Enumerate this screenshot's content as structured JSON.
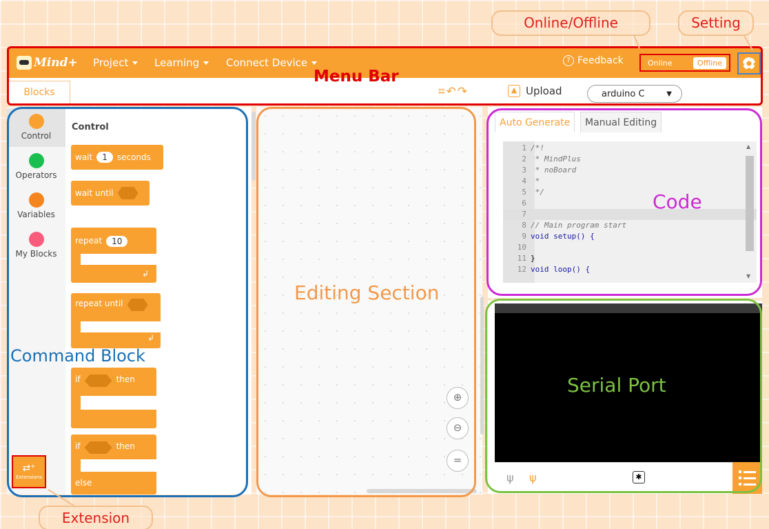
{
  "app": {
    "logo_text": "Mind+"
  },
  "menu": {
    "items": [
      {
        "label": "Project"
      },
      {
        "label": "Learning"
      },
      {
        "label": "Connect Device"
      }
    ],
    "feedback": "Feedback",
    "mode_online": "Online",
    "mode_offline": "Offline"
  },
  "toolbar": {
    "tab_blocks": "Blocks",
    "upload": "Upload",
    "board_select": "arduino C"
  },
  "categories": [
    {
      "label": "Control",
      "color": "#f8a131"
    },
    {
      "label": "Operators",
      "color": "#1bbf4f"
    },
    {
      "label": "Variables",
      "color": "#f5851f"
    },
    {
      "label": "My Blocks",
      "color": "#fa5c7c"
    }
  ],
  "flyout": {
    "title": "Control",
    "wait": {
      "label": "wait",
      "value": "1",
      "unit": "seconds"
    },
    "wait_until": "wait until",
    "repeat": {
      "label": "repeat",
      "value": "10"
    },
    "repeat_until": "repeat until",
    "if_then": {
      "if": "if",
      "then": "then"
    },
    "if_else": {
      "if": "if",
      "then": "then",
      "else": "else"
    }
  },
  "extensions_label": "Extensions",
  "code": {
    "tab_auto": "Auto Generate",
    "tab_manual": "Manual Editing",
    "lines": [
      {
        "n": "1",
        "text": "/*!",
        "cls": "cm"
      },
      {
        "n": "2",
        "text": " * MindPlus",
        "cls": "cm"
      },
      {
        "n": "3",
        "text": " * noBoard",
        "cls": "cm"
      },
      {
        "n": "4",
        "text": " *",
        "cls": "cm"
      },
      {
        "n": "5",
        "text": " */",
        "cls": "cm"
      },
      {
        "n": "6",
        "text": "",
        "cls": ""
      },
      {
        "n": "7",
        "text": "",
        "cls": ""
      },
      {
        "n": "8",
        "text": "// Main program start",
        "cls": "cm"
      },
      {
        "n": "9",
        "text": "void setup() {",
        "cls": "kw"
      },
      {
        "n": "10",
        "text": "",
        "cls": ""
      },
      {
        "n": "11",
        "text": "}",
        "cls": ""
      },
      {
        "n": "12",
        "text": "void loop() {",
        "cls": "kw"
      }
    ]
  },
  "annotations": {
    "menu_bar": "Menu Bar",
    "command_block": "Command Block",
    "editing_section": "Editing Section",
    "code": "Code",
    "serial_port": "Serial Port",
    "online_offline": "Online/Offline",
    "setting": "Setting",
    "extension": "Extension",
    "colors": {
      "menu": "#e00000",
      "command": "#1a6fb5",
      "editing": "#f2994a",
      "code": "#cc2ad4",
      "serial": "#7cc142",
      "callout": "#e0201c"
    }
  }
}
